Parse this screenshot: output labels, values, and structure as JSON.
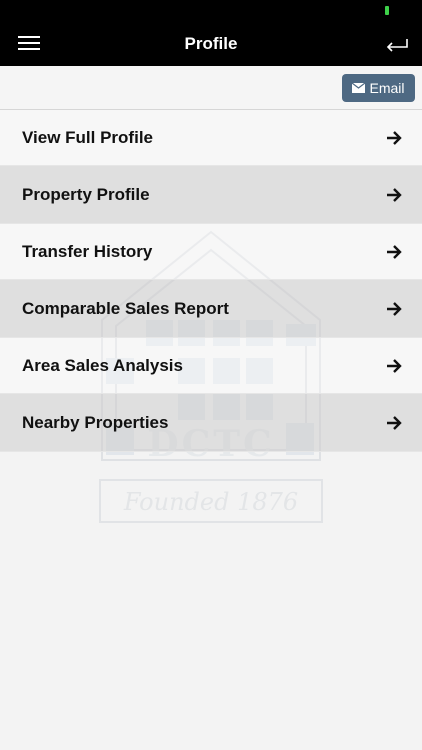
{
  "header": {
    "title": "Profile",
    "menu_icon": "hamburger-icon",
    "back_icon": "return-arrow-icon"
  },
  "toolbar": {
    "email_label": "Email",
    "email_icon": "mail-icon",
    "email_color": "#4e6983"
  },
  "menu": {
    "items": [
      {
        "label": "View Full Profile"
      },
      {
        "label": "Property Profile"
      },
      {
        "label": "Transfer History"
      },
      {
        "label": "Comparable Sales Report"
      },
      {
        "label": "Area Sales Analysis"
      },
      {
        "label": "Nearby Properties"
      }
    ],
    "arrow_icon": "arrow-right-icon"
  },
  "watermark": {
    "logo_text": "DCTC",
    "tagline": "Founded 1876"
  },
  "colors": {
    "nav_background": "#000000",
    "battery": "#3ed14a"
  }
}
